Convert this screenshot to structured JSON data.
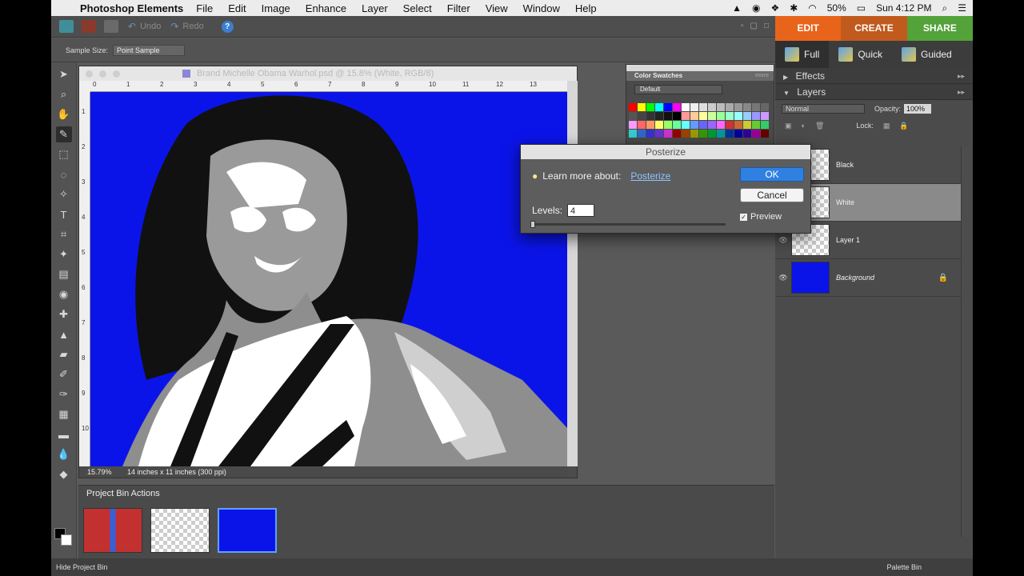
{
  "menubar": {
    "app_name": "Photoshop Elements",
    "items": [
      "File",
      "Edit",
      "Image",
      "Enhance",
      "Layer",
      "Select",
      "Filter",
      "View",
      "Window",
      "Help"
    ],
    "battery": "50%",
    "clock": "Sun 4:12 PM"
  },
  "toolbar": {
    "undo_label": "Undo",
    "redo_label": "Redo"
  },
  "modes": {
    "edit": "EDIT",
    "create": "CREATE",
    "share": "SHARE"
  },
  "options_bar": {
    "sample_size_label": "Sample Size:",
    "sample_size_value": "Point Sample"
  },
  "document": {
    "title": "Brand Michelle Obama Warhol.psd @ 15.8% (White, RGB/8)",
    "zoom": "15.79%",
    "info": "14 inches x 11 inches (300 ppi)",
    "ruler_h": [
      "0",
      "1",
      "2",
      "3",
      "4",
      "5",
      "6",
      "7",
      "8",
      "9",
      "10",
      "11",
      "12",
      "13"
    ],
    "ruler_v": [
      "1",
      "2",
      "3",
      "4",
      "5",
      "6",
      "7",
      "8",
      "9",
      "10"
    ]
  },
  "swatches": {
    "title": "Color Swatches",
    "more": "more",
    "set": "Default",
    "colors": [
      "#ff0000",
      "#ffff00",
      "#00ff00",
      "#00ffff",
      "#0000ff",
      "#ff00ff",
      "#ffffff",
      "#eeeeee",
      "#dddddd",
      "#cccccc",
      "#bbbbbb",
      "#aaaaaa",
      "#999999",
      "#888888",
      "#777777",
      "#666666",
      "#555555",
      "#444444",
      "#333333",
      "#222222",
      "#111111",
      "#000000",
      "#ff9999",
      "#ffcc99",
      "#ffff99",
      "#ccff99",
      "#99ff99",
      "#99ffcc",
      "#99ffff",
      "#99ccff",
      "#9999ff",
      "#cc99ff",
      "#ff99ff",
      "#ff6666",
      "#ff9966",
      "#ffff66",
      "#99ff66",
      "#66ff99",
      "#66ffff",
      "#6699ff",
      "#6666ff",
      "#9966ff",
      "#ff66ff",
      "#cc3333",
      "#cc6633",
      "#cccc33",
      "#66cc33",
      "#33cc66",
      "#33cccc",
      "#3366cc",
      "#3333cc",
      "#6633cc",
      "#cc33cc",
      "#990000",
      "#994400",
      "#999900",
      "#339900",
      "#009933",
      "#009999",
      "#003399",
      "#000099",
      "#330099",
      "#990099",
      "#660000"
    ]
  },
  "right_panel": {
    "modes": [
      "Full",
      "Quick",
      "Guided"
    ],
    "effects_label": "Effects",
    "layers_label": "Layers",
    "blend_mode": "Normal",
    "opacity_label": "Opacity:",
    "opacity_value": "100%",
    "lock_label": "Lock:",
    "layers": [
      {
        "name": "Black"
      },
      {
        "name": "White"
      },
      {
        "name": "Layer 1"
      },
      {
        "name": "Background"
      }
    ]
  },
  "bin": {
    "title": "Project Bin Actions"
  },
  "statusbar": {
    "hide_bin": "Hide Project Bin",
    "palette_bin": "Palette Bin"
  },
  "dialog": {
    "title": "Posterize",
    "learn_label": "Learn more about:",
    "learn_link": "Posterize",
    "levels_label": "Levels:",
    "levels_value": "4",
    "ok_label": "OK",
    "cancel_label": "Cancel",
    "preview_label": "Preview",
    "preview_checked": true
  }
}
